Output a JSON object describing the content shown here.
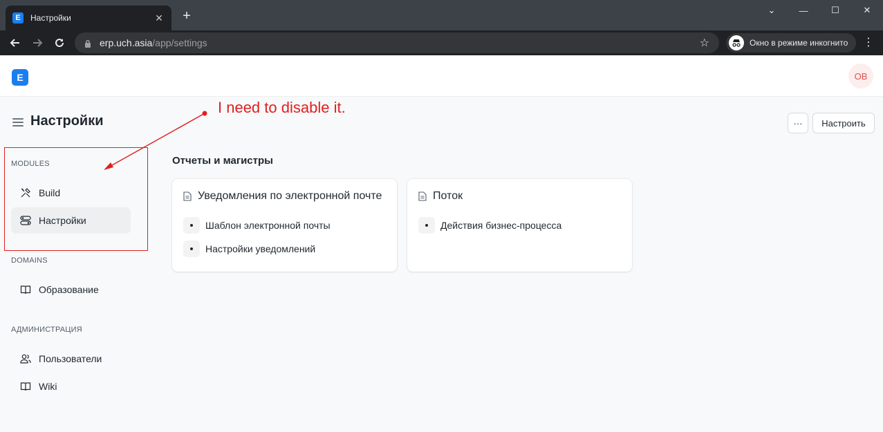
{
  "browser": {
    "tab_title": "Настройки",
    "tab_favicon_letter": "E",
    "url_host": "erp.uch.asia",
    "url_path": "/app/settings",
    "incognito_label": "Окно в режиме инкогнито"
  },
  "navbar": {
    "logo_letter": "E",
    "avatar_initials": "OB"
  },
  "header": {
    "title": "Настройки",
    "more_label": "···",
    "customize_label": "Настроить"
  },
  "sidebar": {
    "sections": [
      {
        "label": "MODULES",
        "items": [
          {
            "label": "Build",
            "icon": "tools-icon",
            "active": false
          },
          {
            "label": "Настройки",
            "icon": "toggles-icon",
            "active": true
          }
        ]
      },
      {
        "label": "DOMAINS",
        "items": [
          {
            "label": "Образование",
            "icon": "book-icon",
            "active": false
          }
        ]
      },
      {
        "label": "АДМИНИСТРАЦИЯ",
        "items": [
          {
            "label": "Пользователи",
            "icon": "users-icon",
            "active": false
          },
          {
            "label": "Wiki",
            "icon": "book-icon",
            "active": false
          }
        ]
      }
    ]
  },
  "main": {
    "section_heading": "Отчеты и магистры",
    "cards": [
      {
        "title": "Уведомления по электронной почте",
        "links": [
          "Шаблон электронной почты",
          "Настройки уведомлений"
        ]
      },
      {
        "title": "Поток",
        "links": [
          "Действия бизнес-процесса"
        ]
      }
    ]
  },
  "annotation": {
    "text": "I need to disable it.",
    "color": "#e02020"
  },
  "colors": {
    "brand": "#1a7ef0",
    "active_item_bg": "#edeff1"
  }
}
